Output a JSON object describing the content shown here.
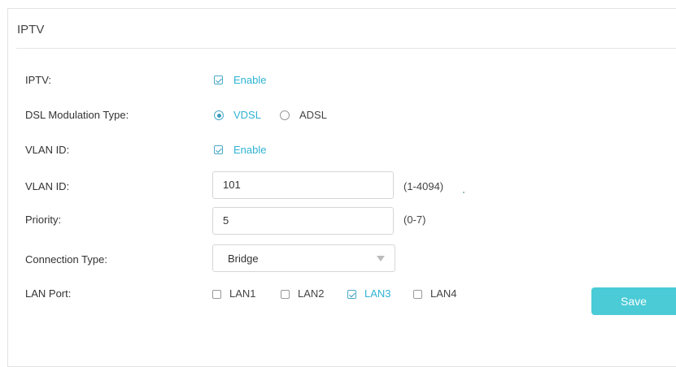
{
  "panel": {
    "title": "IPTV"
  },
  "rows": {
    "iptv": {
      "label": "IPTV:",
      "option": "Enable",
      "checked": true
    },
    "dsl": {
      "label": "DSL Modulation Type:",
      "options": [
        {
          "label": "VDSL",
          "selected": true
        },
        {
          "label": "ADSL",
          "selected": false
        }
      ]
    },
    "vlan_enable": {
      "label": "VLAN ID:",
      "option": "Enable",
      "checked": true
    },
    "vlan_id": {
      "label": "VLAN ID:",
      "value": "101",
      "hint": "(1-4094)"
    },
    "priority": {
      "label": "Priority:",
      "value": "5",
      "hint": "(0-7)"
    },
    "connection": {
      "label": "Connection Type:",
      "value": "Bridge"
    },
    "lan": {
      "label": "LAN Port:",
      "ports": [
        {
          "label": "LAN1",
          "checked": false
        },
        {
          "label": "LAN2",
          "checked": false
        },
        {
          "label": "LAN3",
          "checked": true
        },
        {
          "label": "LAN4",
          "checked": false
        }
      ]
    }
  },
  "save_label": "Save",
  "colors": {
    "accent": "#2fb3d3",
    "button": "#4acbd6"
  }
}
